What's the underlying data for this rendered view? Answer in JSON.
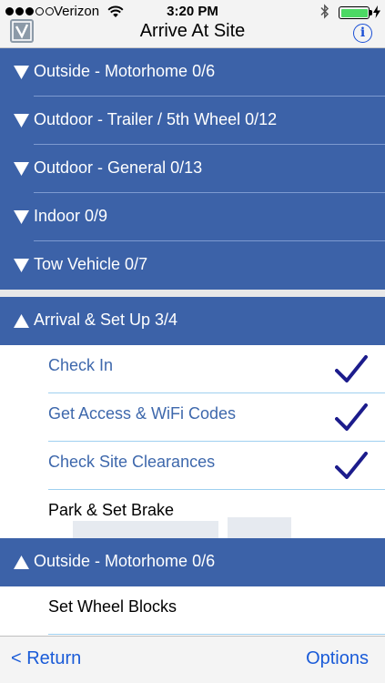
{
  "status_bar": {
    "carrier": "Verizon",
    "time": "3:20 PM",
    "signal_dots_filled": 3,
    "signal_dots_total": 5,
    "battery_level": 1.0
  },
  "nav": {
    "title": "Arrive At Site",
    "info_label": "i",
    "logo_icon": "checkmark-logo-icon"
  },
  "sections_top": [
    {
      "label": "Outside - Motorhome 0/6",
      "expanded": false
    },
    {
      "label": "Outdoor - Trailer / 5th Wheel 0/12",
      "expanded": false
    },
    {
      "label": "Outdoor - General 0/13",
      "expanded": false
    },
    {
      "label": "Indoor 0/9",
      "expanded": false
    },
    {
      "label": "Tow Vehicle 0/7",
      "expanded": false
    }
  ],
  "arrival_section": {
    "label": "Arrival & Set Up 3/4",
    "expanded": true,
    "items": [
      {
        "label": "Check In",
        "checked": true
      },
      {
        "label": "Get Access & WiFi Codes",
        "checked": true
      },
      {
        "label": "Check Site Clearances",
        "checked": true
      },
      {
        "label": "Park & Set Brake",
        "checked": false
      }
    ]
  },
  "outside_section": {
    "label": "Outside - Motorhome 0/6",
    "expanded": true,
    "items": [
      {
        "label": "Set Wheel Blocks",
        "checked": false
      }
    ]
  },
  "toolbar": {
    "return_label": "< Return",
    "options_label": "Options"
  },
  "colors": {
    "section_bg": "#3c62a8",
    "checked_text": "#3e68ac",
    "checkmark": "#1c1c8c",
    "link": "#1a5bd8"
  }
}
